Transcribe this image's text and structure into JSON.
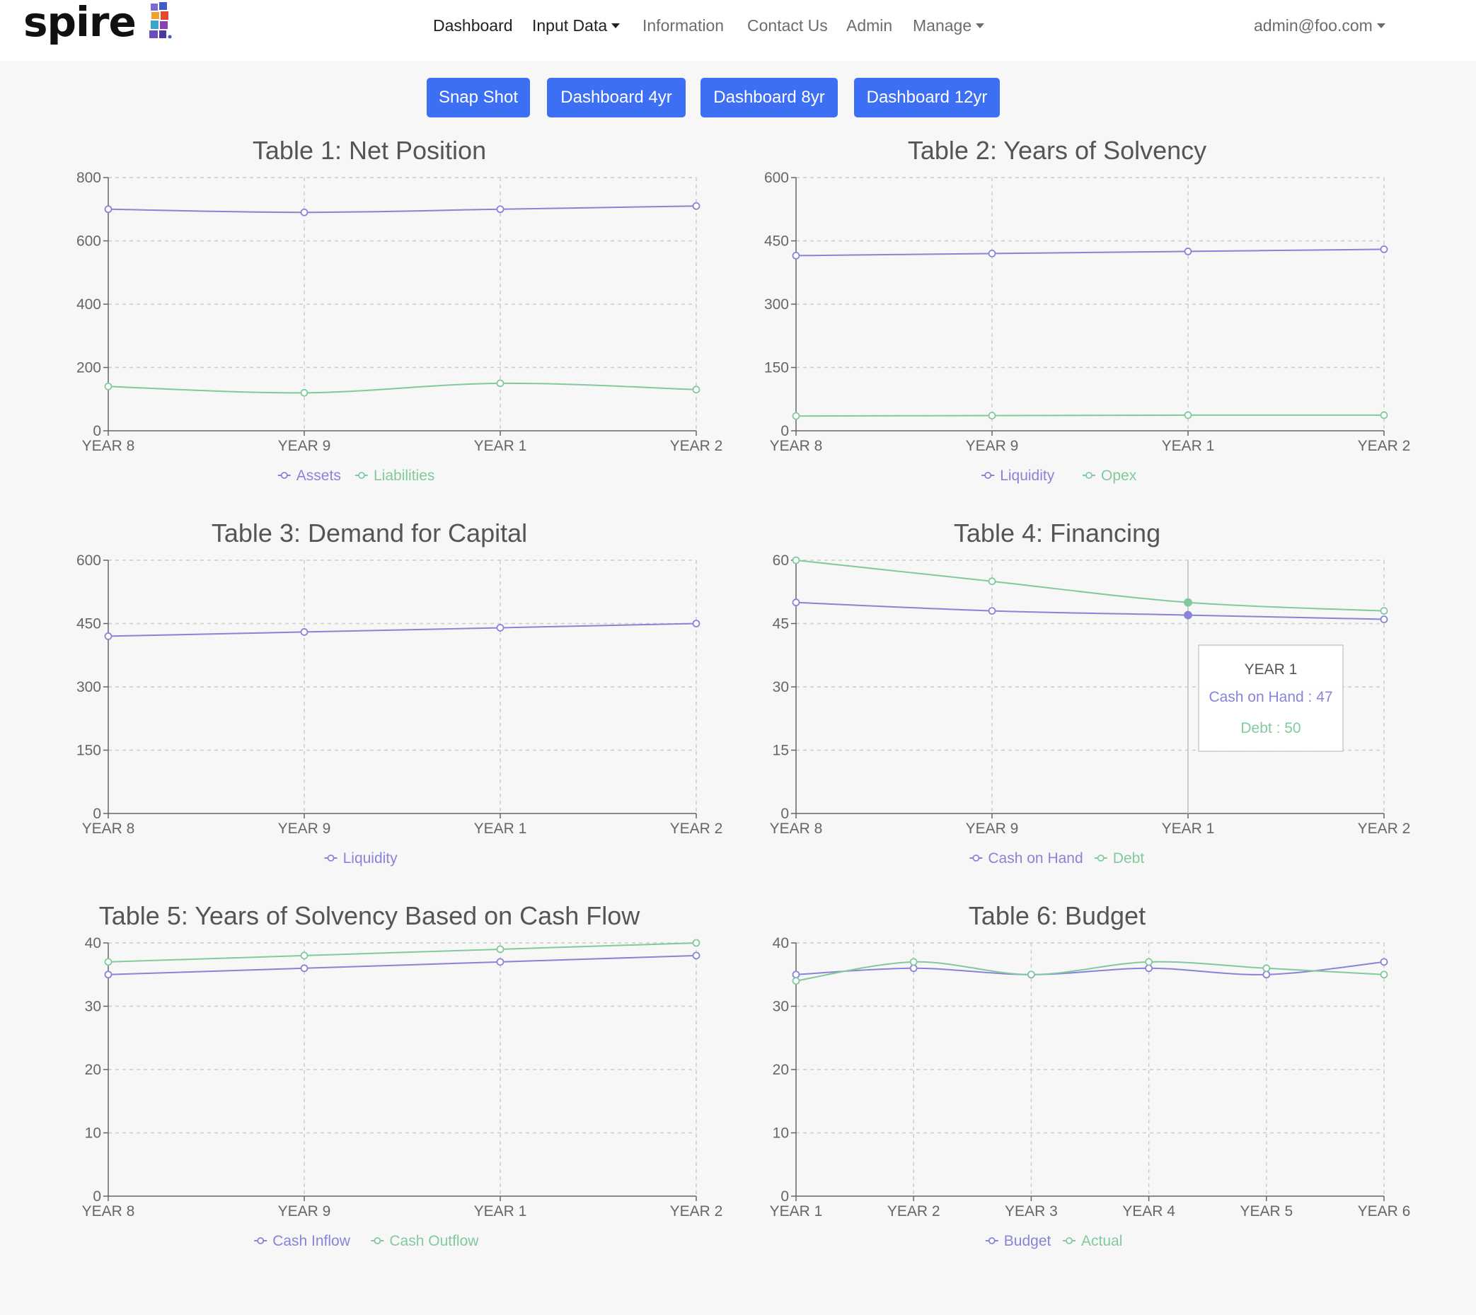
{
  "nav": {
    "logo_text": "spire",
    "links": [
      {
        "label": "Dashboard",
        "active": true,
        "dropdown": false
      },
      {
        "label": "Input Data",
        "active": false,
        "dropdown": true
      },
      {
        "label": "Information",
        "active": false,
        "dropdown": false
      },
      {
        "label": "Contact Us",
        "active": false,
        "dropdown": false
      },
      {
        "label": "Admin",
        "active": false,
        "dropdown": false
      },
      {
        "label": "Manage",
        "active": false,
        "dropdown": true
      }
    ],
    "user_email": "admin@foo.com"
  },
  "buttons": [
    {
      "label": "Snap Shot"
    },
    {
      "label": "Dashboard 4yr"
    },
    {
      "label": "Dashboard 8yr"
    },
    {
      "label": "Dashboard 12yr"
    }
  ],
  "colors": {
    "series1": "#8884d8",
    "series2": "#82ca9d",
    "button": "#3d6ff5",
    "grid": "#cccccc",
    "axis": "#666666",
    "title": "#555555"
  },
  "tooltip": {
    "chart_index": 3,
    "category_index": 2,
    "title": "YEAR 1",
    "lines": [
      {
        "text": "Cash on Hand : 47",
        "series": 0
      },
      {
        "text": "Debt : 50",
        "series": 1
      }
    ]
  },
  "chart_data": [
    {
      "type": "line",
      "title": "Table 1: Net Position",
      "categories": [
        "YEAR 8",
        "YEAR 9",
        "YEAR 1",
        "YEAR 2"
      ],
      "ylim": [
        0,
        800
      ],
      "yticks": [
        0,
        200,
        400,
        600,
        800
      ],
      "series": [
        {
          "name": "Assets",
          "values": [
            700,
            690,
            700,
            710
          ]
        },
        {
          "name": "Liabilities",
          "values": [
            140,
            120,
            150,
            130
          ]
        }
      ],
      "grid": true,
      "legend": "bottom-center"
    },
    {
      "type": "line",
      "title": "Table 2: Years of Solvency",
      "categories": [
        "YEAR 8",
        "YEAR 9",
        "YEAR 1",
        "YEAR 2"
      ],
      "ylim": [
        0,
        600
      ],
      "yticks": [
        0,
        150,
        300,
        450,
        600
      ],
      "series": [
        {
          "name": "Liquidity",
          "values": [
            415,
            420,
            425,
            430
          ]
        },
        {
          "name": "Opex",
          "values": [
            35,
            36,
            37,
            37
          ]
        }
      ],
      "grid": true,
      "legend": "bottom-center"
    },
    {
      "type": "line",
      "title": "Table 3: Demand for Capital",
      "categories": [
        "YEAR 8",
        "YEAR 9",
        "YEAR 1",
        "YEAR 2"
      ],
      "ylim": [
        0,
        600
      ],
      "yticks": [
        0,
        150,
        300,
        450,
        600
      ],
      "series": [
        {
          "name": "Liquidity",
          "values": [
            420,
            430,
            440,
            450
          ]
        }
      ],
      "grid": true,
      "legend": "bottom-center"
    },
    {
      "type": "line",
      "title": "Table 4: Financing",
      "categories": [
        "YEAR 8",
        "YEAR 9",
        "YEAR 1",
        "YEAR 2"
      ],
      "ylim": [
        0,
        60
      ],
      "yticks": [
        0,
        15,
        30,
        45,
        60
      ],
      "series": [
        {
          "name": "Cash on Hand",
          "values": [
            50,
            48,
            47,
            46
          ]
        },
        {
          "name": "Debt",
          "values": [
            60,
            55,
            50,
            48
          ]
        }
      ],
      "grid": true,
      "legend": "bottom-center"
    },
    {
      "type": "line",
      "title": "Table 5: Years of Solvency Based on Cash Flow",
      "categories": [
        "YEAR 8",
        "YEAR 9",
        "YEAR 1",
        "YEAR 2"
      ],
      "ylim": [
        0,
        40
      ],
      "yticks": [
        0,
        10,
        20,
        30,
        40
      ],
      "series": [
        {
          "name": "Cash Inflow",
          "values": [
            35,
            36,
            37,
            38
          ]
        },
        {
          "name": "Cash Outflow",
          "values": [
            37,
            38,
            39,
            40
          ]
        }
      ],
      "grid": true,
      "legend": "bottom-center"
    },
    {
      "type": "line",
      "title": "Table 6: Budget",
      "categories": [
        "YEAR 1",
        "YEAR 2",
        "YEAR 3",
        "YEAR 4",
        "YEAR 5",
        "YEAR 6"
      ],
      "ylim": [
        0,
        40
      ],
      "yticks": [
        0,
        10,
        20,
        30,
        40
      ],
      "series": [
        {
          "name": "Budget",
          "values": [
            35,
            36,
            35,
            36,
            35,
            37
          ]
        },
        {
          "name": "Actual",
          "values": [
            34,
            37,
            35,
            37,
            36,
            35
          ]
        }
      ],
      "grid": true,
      "legend": "bottom-center"
    }
  ]
}
